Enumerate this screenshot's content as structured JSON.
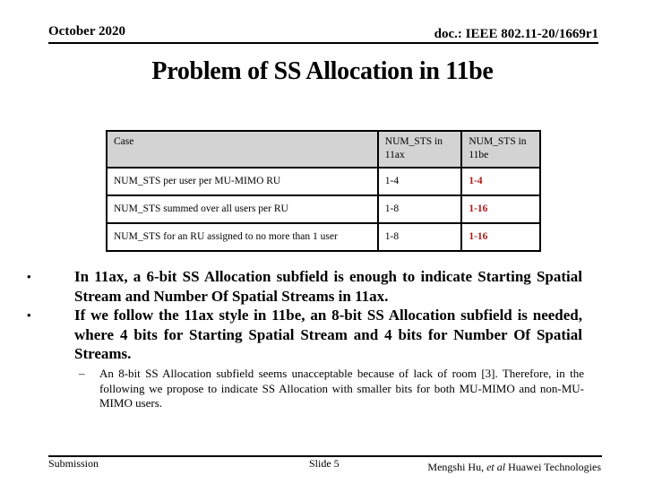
{
  "header": {
    "date": "October 2020",
    "doc_id": "doc.: IEEE 802.11-20/1669r1"
  },
  "title": "Problem of SS Allocation in 11be",
  "table": {
    "columns": [
      "Case",
      "NUM_STS in 11ax",
      "NUM_STS in 11be"
    ],
    "rows": [
      [
        "NUM_STS per user per MU-MIMO RU",
        "1-4",
        "1-4"
      ],
      [
        "NUM_STS summed over all users per RU",
        "1-8",
        "1-16"
      ],
      [
        "NUM_STS for an RU assigned to no more than 1 user",
        "1-8",
        "1-16"
      ]
    ],
    "highlight_color": "#b01818",
    "header_bg": "#d3d3d3"
  },
  "bullets": [
    "In 11ax, a 6-bit SS Allocation subfield is enough to indicate Starting Spatial Stream and Number Of Spatial Streams in 11ax.",
    "If we follow the 11ax style in 11be, an 8-bit SS Allocation subfield is needed, where 4 bits for Starting Spatial Stream and 4 bits for Number Of Spatial Streams."
  ],
  "bullet_glyph": "•",
  "sub_bullets": [
    "An 8-bit SS Allocation subfield seems unacceptable because of lack of room [3]. Therefore, in the following we propose to indicate SS Allocation with smaller bits for both MU-MIMO and non-MU-MIMO users."
  ],
  "sub_glyph": "–",
  "footer": {
    "left": "Submission",
    "center": "Slide 5",
    "author": "Mengshi Hu, ",
    "etal": "et al",
    "org": " Huawei Technologies"
  }
}
